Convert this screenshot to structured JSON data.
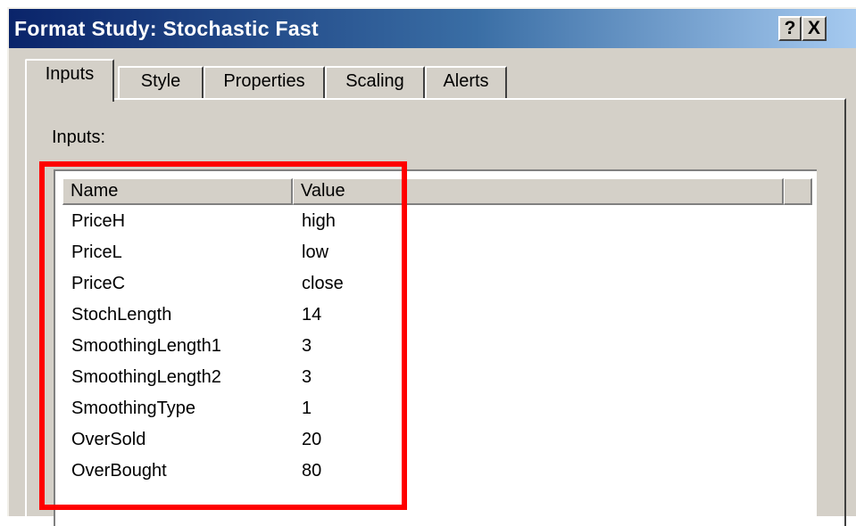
{
  "window": {
    "title": "Format Study: Stochastic Fast",
    "help_label": "?",
    "close_label": "X"
  },
  "tabs": [
    {
      "label": "Inputs",
      "active": true
    },
    {
      "label": "Style",
      "active": false
    },
    {
      "label": "Properties",
      "active": false
    },
    {
      "label": "Scaling",
      "active": false
    },
    {
      "label": "Alerts",
      "active": false
    }
  ],
  "inputs_section": {
    "label": "Inputs:",
    "columns": {
      "name": "Name",
      "value": "Value"
    },
    "rows": [
      {
        "name": "PriceH",
        "value": "high"
      },
      {
        "name": "PriceL",
        "value": "low"
      },
      {
        "name": "PriceC",
        "value": "close"
      },
      {
        "name": "StochLength",
        "value": "14"
      },
      {
        "name": "SmoothingLength1",
        "value": "3"
      },
      {
        "name": "SmoothingLength2",
        "value": "3"
      },
      {
        "name": "SmoothingType",
        "value": "1"
      },
      {
        "name": "OverSold",
        "value": "20"
      },
      {
        "name": "OverBought",
        "value": "80"
      }
    ]
  },
  "highlight_color": "#ff0000",
  "titlebar_color": "#0a246a"
}
